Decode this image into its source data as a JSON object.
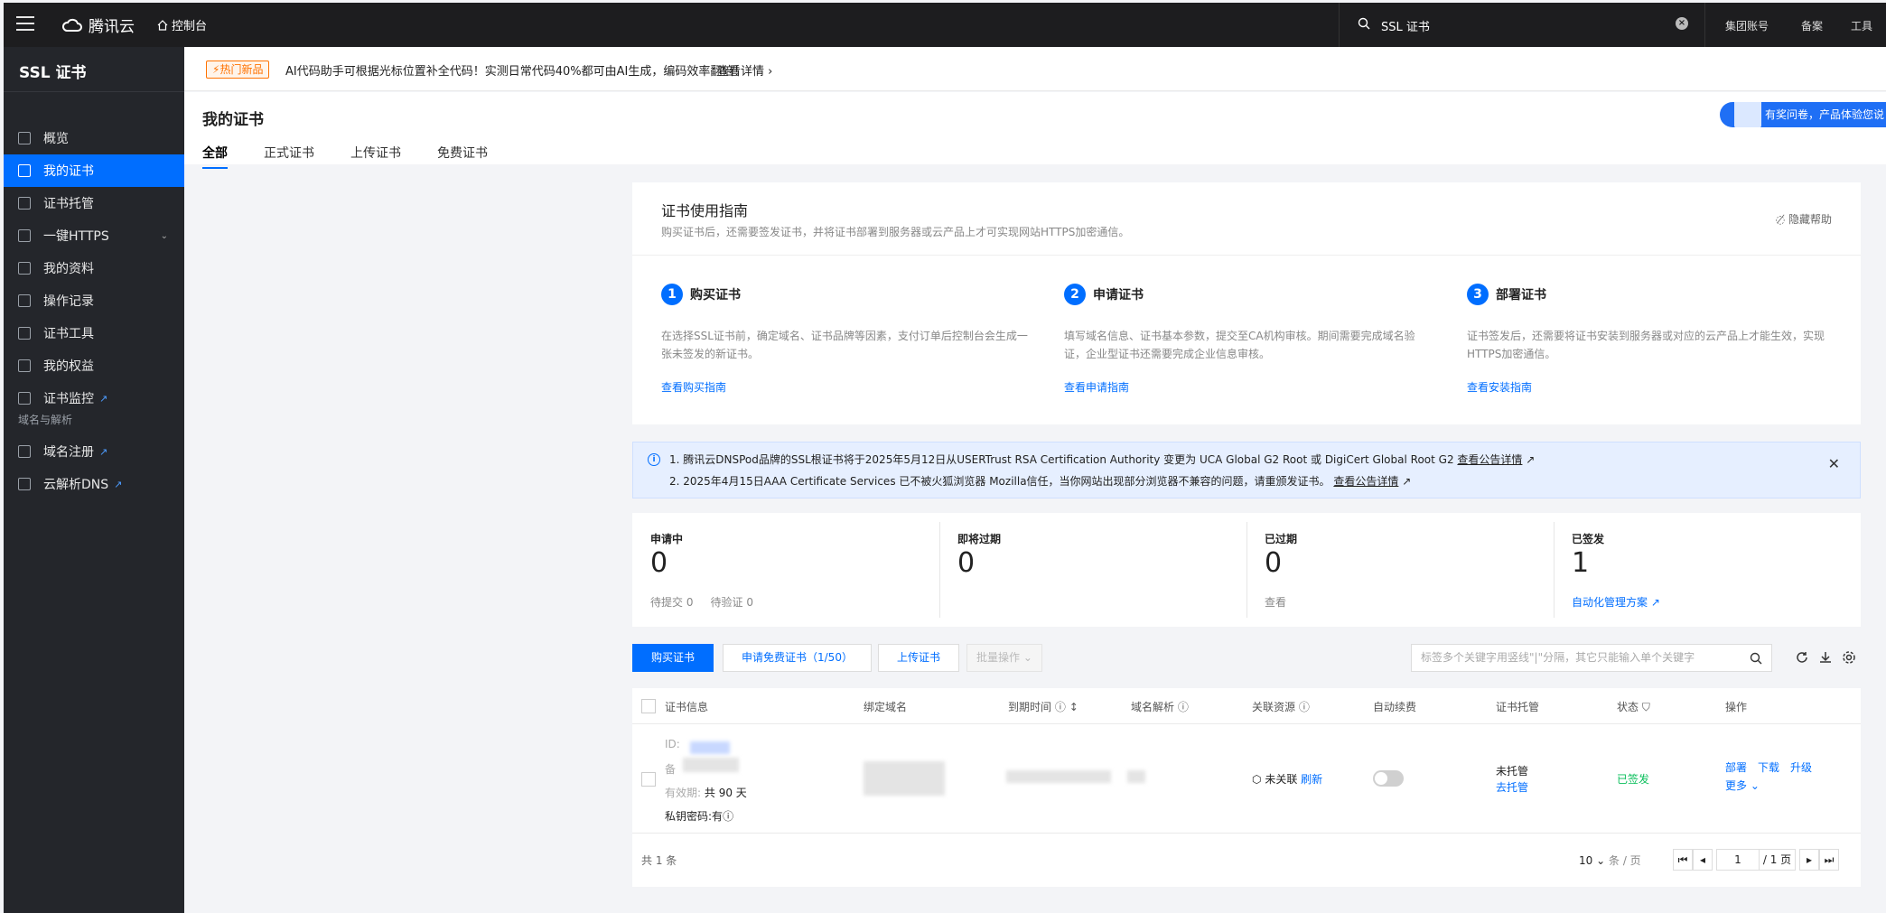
{
  "topbar": {
    "brand": "腾讯云",
    "console": "控制台",
    "search_value": "SSL 证书",
    "links": [
      "集团账号",
      "备案",
      "工具"
    ]
  },
  "sidebar": {
    "title": "SSL 证书",
    "items": [
      {
        "label": "概览",
        "icon": "grid-icon"
      },
      {
        "label": "我的证书",
        "icon": "certificate-icon"
      },
      {
        "label": "证书托管",
        "icon": "hosting-icon"
      },
      {
        "label": "一键HTTPS",
        "icon": "https-icon"
      },
      {
        "label": "我的资料",
        "icon": "folder-icon"
      },
      {
        "label": "操作记录",
        "icon": "log-icon"
      },
      {
        "label": "证书工具",
        "icon": "tool-icon"
      },
      {
        "label": "我的权益",
        "icon": "gift-icon"
      },
      {
        "label": "证书监控",
        "icon": "monitor-icon"
      }
    ],
    "group_label": "域名与解析",
    "group_items": [
      {
        "label": "域名注册",
        "icon": "domain-icon"
      },
      {
        "label": "云解析DNS",
        "icon": "dns-icon"
      }
    ]
  },
  "notice": {
    "badge": "热门新品",
    "text": "AI代码助手可根据光标位置补全代码！实测日常代码40%都可由AI生成，编码效率翻倍！",
    "more": "查看详情"
  },
  "page": {
    "title": "我的证书",
    "tabs": [
      "全部",
      "正式证书",
      "上传证书",
      "免费证书"
    ],
    "survey": "有奖问卷，产品体验您说"
  },
  "guide": {
    "title": "证书使用指南",
    "subtitle": "购买证书后，还需要签发证书，并将证书部署到服务器或云产品上才可实现网站HTTPS加密通信。",
    "hide": "隐藏帮助",
    "steps": [
      {
        "num": "1",
        "name": "购买证书",
        "desc": "在选择SSL证书前，确定域名、证书品牌等因素，支付订单后控制台会生成一张未签发的新证书。",
        "link": "查看购买指南"
      },
      {
        "num": "2",
        "name": "申请证书",
        "desc": "填写域名信息、证书基本参数，提交至CA机构审核。期间需要完成域名验证，企业型证书还需要完成企业信息审核。",
        "link": "查看申请指南"
      },
      {
        "num": "3",
        "name": "部署证书",
        "desc": "证书签发后，还需要将证书安装到服务器或对应的云产品上才能生效，实现HTTPS加密通信。",
        "link": "查看安装指南"
      }
    ]
  },
  "announce": {
    "line1": "1. 腾讯云DNSPod品牌的SSL根证书将于2025年5月12日从USERTrust RSA Certification Authority 变更为 UCA Global G2 Root 或 DigiCert Global Root G2",
    "line1_link": "查看公告详情",
    "line2": "2. 2025年4月15日AAA Certificate Services 已不被火狐浏览器 Mozilla信任，当你网站出现部分浏览器不兼容的问题，请重颁发证书。",
    "line2_link": "查看公告详情"
  },
  "stats": [
    {
      "label": "申请中",
      "value": "0",
      "sub1": "待提交 0",
      "sub2": "待验证 0"
    },
    {
      "label": "即将过期",
      "value": "0"
    },
    {
      "label": "已过期",
      "value": "0",
      "sub1": "查看"
    },
    {
      "label": "已签发",
      "value": "1",
      "sub1": "自动化管理方案"
    }
  ],
  "toolbar": {
    "buy": "购买证书",
    "free": "申请免费证书（1/50）",
    "upload": "上传证书",
    "batch": "批量操作",
    "search_placeholder": "标签多个关键字用竖线\"|\"分隔，其它只能输入单个关键字"
  },
  "table": {
    "headers": [
      "证书信息",
      "绑定域名",
      "到期时间",
      "域名解析",
      "关联资源",
      "自动续费",
      "证书托管",
      "状态",
      "操作"
    ],
    "row": {
      "id_label": "ID:",
      "note_label": "备",
      "validity_label": "有效期:",
      "validity_value": "共 90 天",
      "pk_label": "私钥密码:",
      "pk_value": "有",
      "resource": "未关联",
      "refresh": "刷新",
      "hosting": "未托管",
      "hosting_link": "去托管",
      "status": "已签发",
      "actions": [
        "部署",
        "下载",
        "升级"
      ],
      "more": "更多"
    },
    "total": "共 1 条",
    "page_size": "10",
    "per_page": "条 / 页",
    "page": "1",
    "pages": "/ 1 页"
  },
  "colors": {
    "accent": "#006eff",
    "success": "#0abf5b",
    "warning": "#ff7200"
  }
}
